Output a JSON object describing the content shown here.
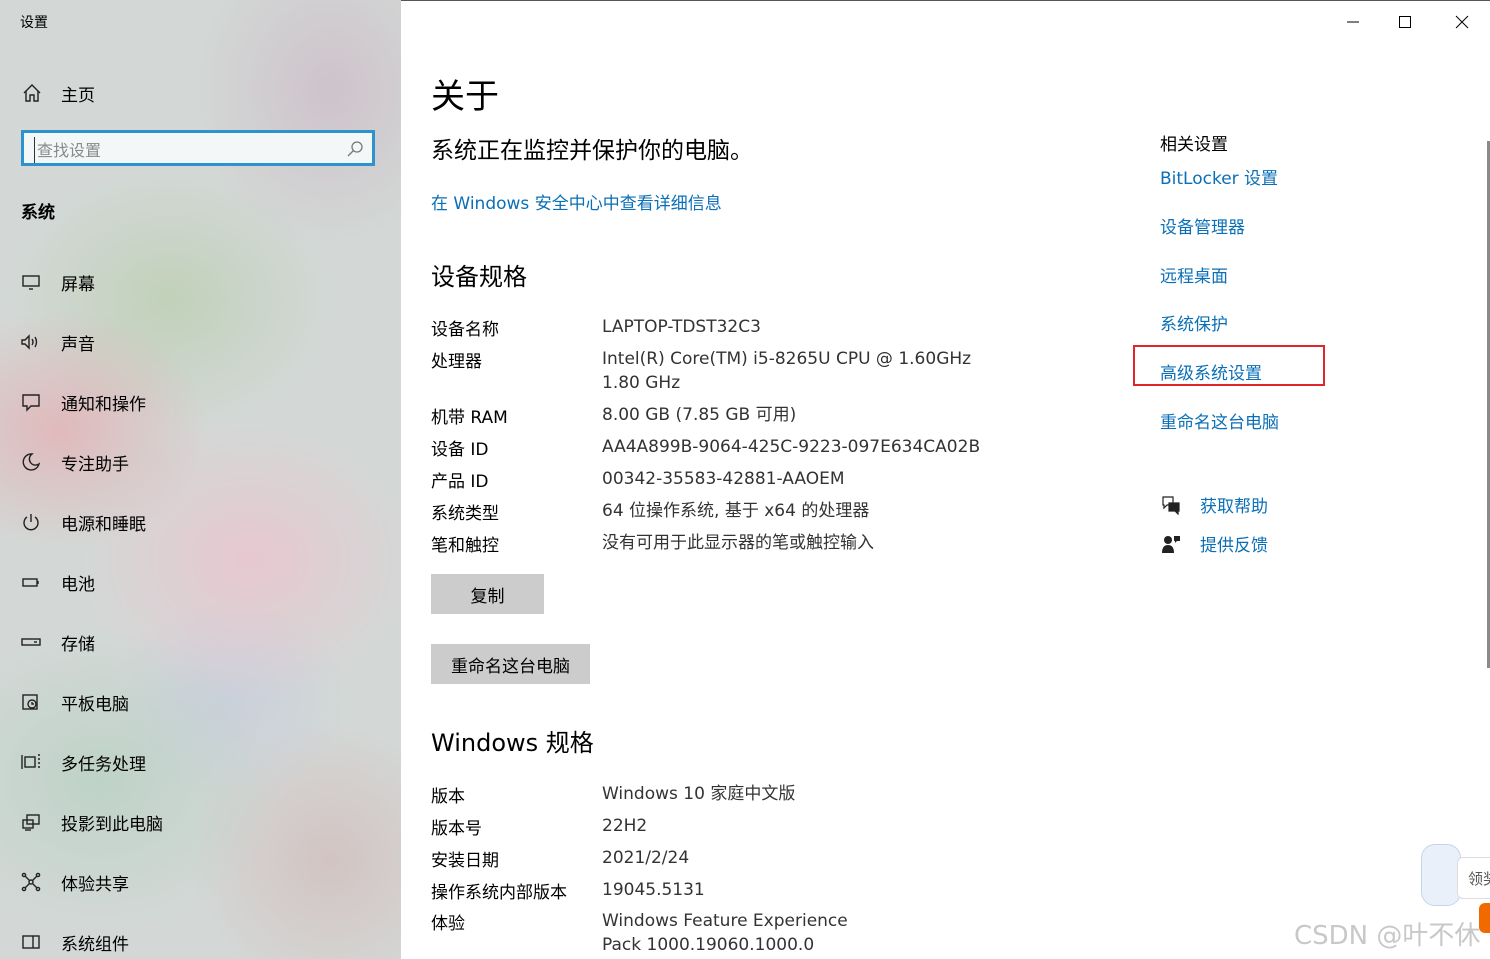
{
  "app": {
    "title": "设置"
  },
  "sidebar": {
    "home_label": "主页",
    "search_placeholder": "查找设置",
    "section": "系统",
    "items": [
      {
        "label": "屏幕",
        "icon": "monitor-icon"
      },
      {
        "label": "声音",
        "icon": "speaker-icon"
      },
      {
        "label": "通知和操作",
        "icon": "notification-icon"
      },
      {
        "label": "专注助手",
        "icon": "moon-icon"
      },
      {
        "label": "电源和睡眠",
        "icon": "power-icon"
      },
      {
        "label": "电池",
        "icon": "battery-icon"
      },
      {
        "label": "存储",
        "icon": "storage-icon"
      },
      {
        "label": "平板电脑",
        "icon": "tablet-icon"
      },
      {
        "label": "多任务处理",
        "icon": "multitask-icon"
      },
      {
        "label": "投影到此电脑",
        "icon": "project-icon"
      },
      {
        "label": "体验共享",
        "icon": "share-icon"
      },
      {
        "label": "系统组件",
        "icon": "components-icon"
      }
    ]
  },
  "main": {
    "title": "关于",
    "status": "系统正在监控并保护你的电脑。",
    "security_link": "在 Windows 安全中心中查看详细信息",
    "device_specs": {
      "heading": "设备规格",
      "rows": [
        {
          "k": "设备名称",
          "v": "LAPTOP-TDST32C3"
        },
        {
          "k": "处理器",
          "v": "Intel(R) Core(TM) i5-8265U CPU @ 1.60GHz   1.80 GHz"
        },
        {
          "k": "机带 RAM",
          "v": "8.00 GB (7.85 GB 可用)"
        },
        {
          "k": "设备 ID",
          "v": "AA4A899B-9064-425C-9223-097E634CA02B"
        },
        {
          "k": "产品 ID",
          "v": "00342-35583-42881-AAOEM"
        },
        {
          "k": "系统类型",
          "v": "64 位操作系统, 基于 x64 的处理器"
        },
        {
          "k": "笔和触控",
          "v": "没有可用于此显示器的笔或触控输入"
        }
      ],
      "copy_button": "复制",
      "rename_button": "重命名这台电脑"
    },
    "windows_specs": {
      "heading": "Windows 规格",
      "rows": [
        {
          "k": "版本",
          "v": "Windows 10 家庭中文版"
        },
        {
          "k": "版本号",
          "v": "22H2"
        },
        {
          "k": "安装日期",
          "v": "2021/2/24"
        },
        {
          "k": "操作系统内部版本",
          "v": "19045.5131"
        },
        {
          "k": "体验",
          "v": "Windows Feature Experience Pack 1000.19060.1000.0"
        }
      ]
    }
  },
  "related": {
    "title": "相关设置",
    "links": [
      "BitLocker 设置",
      "设备管理器",
      "远程桌面",
      "系统保护",
      "高级系统设置",
      "重命名这台电脑"
    ],
    "help": "获取帮助",
    "feedback": "提供反馈"
  },
  "overlay": {
    "watermark": "CSDN @叶不休",
    "widget_tab": "领奖"
  },
  "colors": {
    "accent": "#2d93cf",
    "link": "#0a6fb7",
    "highlight": "#e0262b"
  }
}
